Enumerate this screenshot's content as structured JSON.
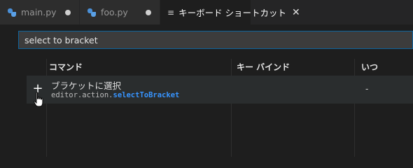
{
  "tabs": [
    {
      "label": "main.py",
      "icon": "python-icon",
      "modified": true
    },
    {
      "label": "foo.py",
      "icon": "python-icon",
      "modified": true
    },
    {
      "label": "キーボード ショートカット",
      "icon": "keyboard-shortcuts-icon",
      "close": "✕",
      "active": true
    }
  ],
  "search": {
    "value": "select to bracket"
  },
  "columns": {
    "command": "コマンド",
    "keybinding": "キー バインド",
    "when": "いつ"
  },
  "rows": [
    {
      "name": "ブラケットに選択",
      "command_prefix": "editor.action.",
      "command_match": "selectToBracket",
      "keybinding": "",
      "when": "-",
      "add_button": "+"
    }
  ],
  "colors": {
    "accent": "#0e639c",
    "highlight": "#3794ff",
    "background": "#1e1e1e"
  }
}
